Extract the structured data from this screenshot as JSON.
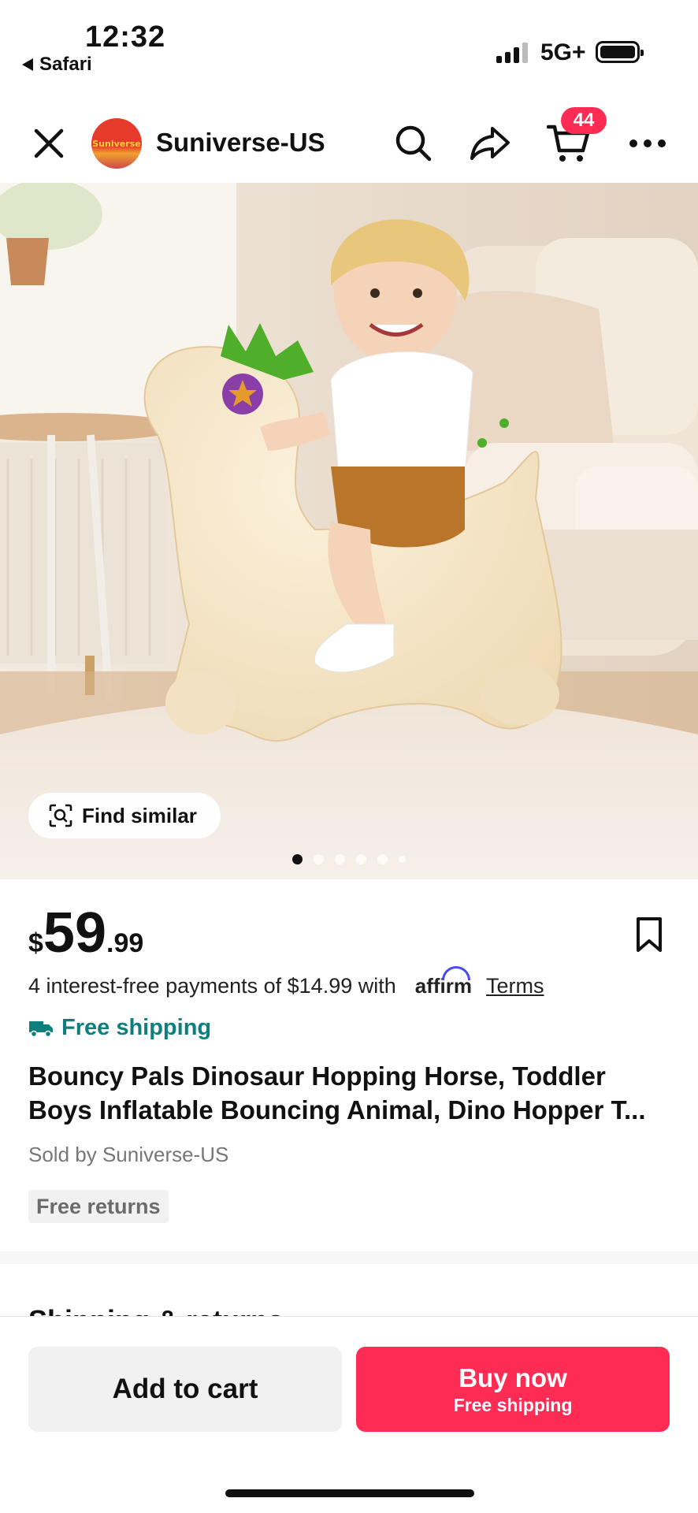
{
  "status_bar": {
    "time": "12:32",
    "back_app": "Safari",
    "network": "5G+"
  },
  "nav": {
    "store_name": "Suniverse-US",
    "logo_text": "Suniverse",
    "cart_count": "44",
    "icons": [
      "close-icon",
      "search-icon",
      "share-icon",
      "cart-icon",
      "more-icon"
    ]
  },
  "gallery": {
    "find_similar_label": "Find similar",
    "image_count": 6,
    "active_index": 0
  },
  "product": {
    "price_currency": "$",
    "price_integer": "59",
    "price_decimal": ".99",
    "installments_text": "4 interest-free payments of $14.99 with",
    "affirm_label": "affirm",
    "terms_label": "Terms",
    "free_shipping_label": "Free shipping",
    "title": "Bouncy Pals Dinosaur Hopping Horse, Toddler Boys Inflatable Bouncing Animal, Dino Hopper T...",
    "sold_by": "Sold by Suniverse-US",
    "returns_badge": "Free returns"
  },
  "next_section": {
    "title": "Shipping & returns"
  },
  "actions": {
    "add_to_cart": "Add to cart",
    "buy_now": "Buy now",
    "buy_now_sub": "Free shipping"
  },
  "colors": {
    "accent": "#fe2c55",
    "shipping_teal": "#0f7f7d",
    "affirm_blue": "#4a4af4"
  }
}
